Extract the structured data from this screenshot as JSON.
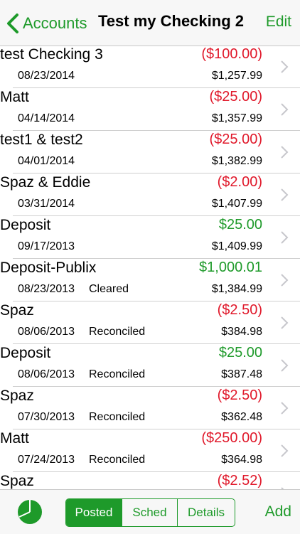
{
  "nav": {
    "back_label": "Accounts",
    "title": "Test my Checking 2",
    "edit_label": "Edit"
  },
  "transactions": [
    {
      "payee": "test Checking 3",
      "amount": "($100.00)",
      "sign": "neg",
      "date": "08/23/2014",
      "status": "",
      "balance": "$1,257.99"
    },
    {
      "payee": "Matt",
      "amount": "($25.00)",
      "sign": "neg",
      "date": "04/14/2014",
      "status": "",
      "balance": "$1,357.99"
    },
    {
      "payee": "test1 & test2",
      "amount": "($25.00)",
      "sign": "neg",
      "date": "04/01/2014",
      "status": "",
      "balance": "$1,382.99"
    },
    {
      "payee": "Spaz & Eddie",
      "amount": "($2.00)",
      "sign": "neg",
      "date": "03/31/2014",
      "status": "",
      "balance": "$1,407.99"
    },
    {
      "payee": "Deposit",
      "amount": "$25.00",
      "sign": "pos",
      "date": "09/17/2013",
      "status": "",
      "balance": "$1,409.99"
    },
    {
      "payee": "Deposit-Publix",
      "amount": "$1,000.01",
      "sign": "pos",
      "date": "08/23/2013",
      "status": "Cleared",
      "balance": "$1,384.99"
    },
    {
      "payee": "Spaz",
      "amount": "($2.50)",
      "sign": "neg",
      "date": "08/06/2013",
      "status": "Reconciled",
      "balance": "$384.98"
    },
    {
      "payee": "Deposit",
      "amount": "$25.00",
      "sign": "pos",
      "date": "08/06/2013",
      "status": "Reconciled",
      "balance": "$387.48"
    },
    {
      "payee": "Spaz",
      "amount": "($2.50)",
      "sign": "neg",
      "date": "07/30/2013",
      "status": "Reconciled",
      "balance": "$362.48"
    },
    {
      "payee": "Matt",
      "amount": "($250.00)",
      "sign": "neg",
      "date": "07/24/2013",
      "status": "Reconciled",
      "balance": "$364.98"
    },
    {
      "payee": "Spaz",
      "amount": "($2.52)",
      "sign": "neg",
      "date": "",
      "status": "",
      "balance": ""
    }
  ],
  "toolbar": {
    "segments": [
      {
        "label": "Posted",
        "active": true
      },
      {
        "label": "Sched",
        "active": false
      },
      {
        "label": "Details",
        "active": false
      }
    ],
    "add_label": "Add",
    "chart_icon": "pie-chart-icon"
  },
  "colors": {
    "accent": "#1e9a2a",
    "negative": "#e0182a",
    "positive": "#1e9a2a"
  }
}
